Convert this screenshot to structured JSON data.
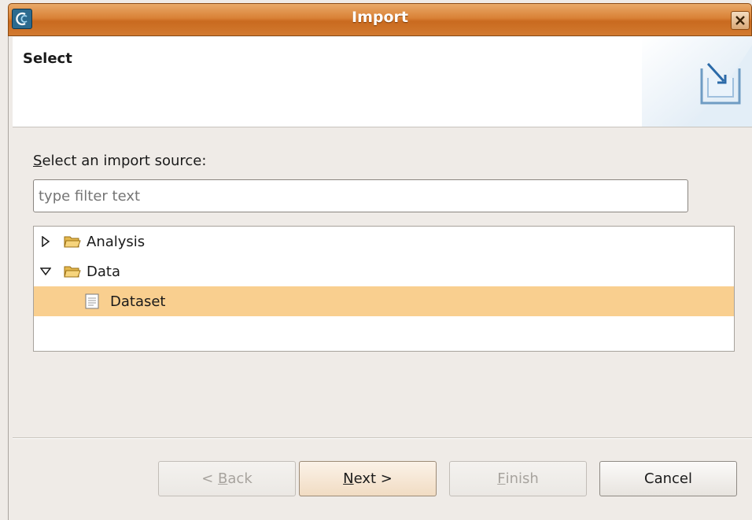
{
  "window": {
    "title": "Import"
  },
  "header": {
    "title": "Select"
  },
  "source": {
    "label_mnemonic": "S",
    "label_rest": "elect an import source:",
    "filter_placeholder": "type filter text"
  },
  "tree": {
    "items": [
      {
        "label": "Analysis",
        "state": "collapsed",
        "icon": "folder-icon"
      },
      {
        "label": "Data",
        "state": "expanded",
        "icon": "folder-icon"
      },
      {
        "label": "Dataset",
        "state": "selected",
        "icon": "file-icon"
      }
    ]
  },
  "buttons": {
    "back_prefix": "< ",
    "back_mnemonic": "B",
    "back_rest": "ack",
    "next_mnemonic": "N",
    "next_rest": "ext >",
    "finish_mnemonic": "F",
    "finish_rest": "inish",
    "cancel_label": "Cancel"
  },
  "colors": {
    "titlebar": "#d98136",
    "selection": "#f9cf8f"
  }
}
